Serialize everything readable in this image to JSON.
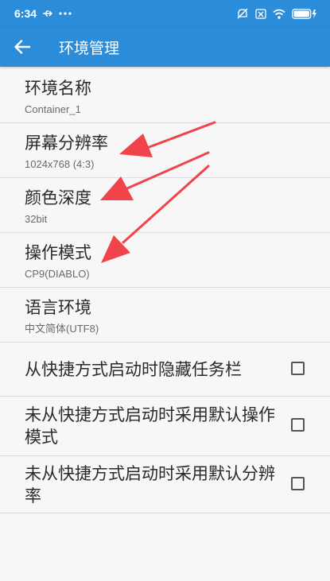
{
  "status_bar": {
    "time": "6:34",
    "left_icons": [
      "usb-icon",
      "more-dots-icon"
    ],
    "right_icons": [
      "mute-icon",
      "sim-icon",
      "wifi-icon",
      "battery-icon"
    ]
  },
  "app_bar": {
    "title": "环境管理",
    "back_icon": "arrow-back-icon"
  },
  "items": [
    {
      "title": "环境名称",
      "subtitle": "Container_1"
    },
    {
      "title": "屏幕分辨率",
      "subtitle": "1024x768 (4:3)"
    },
    {
      "title": "颜色深度",
      "subtitle": "32bit"
    },
    {
      "title": "操作模式",
      "subtitle": "CP9(DIABLO)"
    },
    {
      "title": "语言环境",
      "subtitle": "中文简体(UTF8)"
    }
  ],
  "checkbox_items": [
    {
      "label": "从快捷方式启动时隐藏任务栏",
      "checked": false
    },
    {
      "label": "未从快捷方式启动时采用默认操作模式",
      "checked": false
    },
    {
      "label": "未从快捷方式启动时采用默认分辨率",
      "checked": false
    }
  ],
  "colors": {
    "accent": "#2b8cd9",
    "arrow": "#f0434a"
  }
}
